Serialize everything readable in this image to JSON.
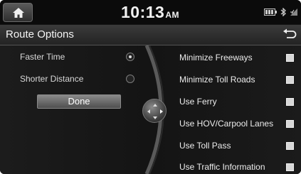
{
  "status": {
    "time": "10:13",
    "ampm": "AM"
  },
  "icons": {
    "home": "home-icon",
    "back": "back-arrow-icon",
    "battery": "battery-icon",
    "bluetooth": "bluetooth-icon",
    "signal": "signal-icon"
  },
  "header": {
    "title": "Route Options"
  },
  "left_options": [
    {
      "label": "Faster Time",
      "selected": true
    },
    {
      "label": "Shorter Distance",
      "selected": false
    }
  ],
  "done_label": "Done",
  "right_options": [
    {
      "label": "Minimize Freeways"
    },
    {
      "label": "Minimize Toll Roads"
    },
    {
      "label": "Use Ferry"
    },
    {
      "label": "Use HOV/Carpool Lanes"
    },
    {
      "label": "Use Toll Pass"
    },
    {
      "label": "Use Traffic Information"
    }
  ]
}
